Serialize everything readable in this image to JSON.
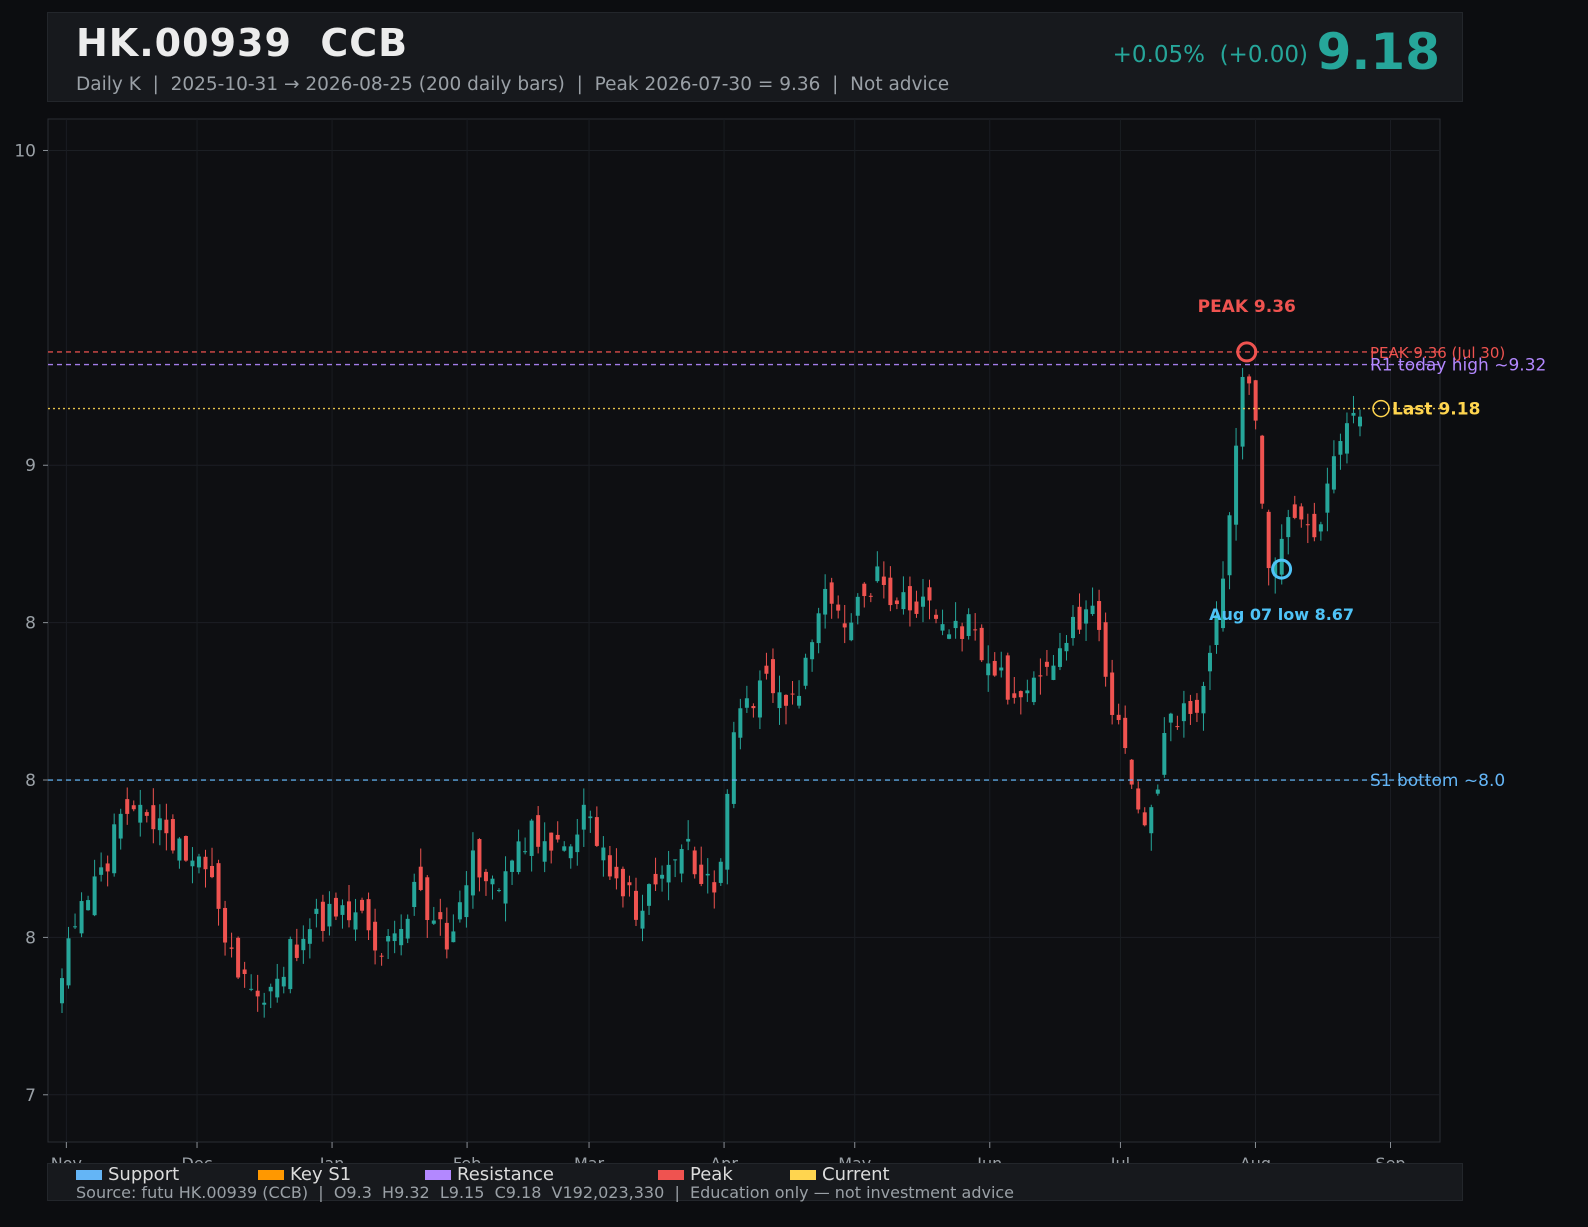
{
  "header": {
    "ticker": "HK.00939  CCB",
    "subtitle": "Daily K  |  2025-10-31 → 2026-08-25 (200 daily bars)  |  Peak 2026-07-30 = 9.36  |  Not advice",
    "change": "+0.05%  (+0.00)",
    "price": "9.18"
  },
  "legend": {
    "items": [
      {
        "label": "Support",
        "color": "#64b5f6"
      },
      {
        "label": "Key S1",
        "color": "#ff9800"
      },
      {
        "label": "Resistance",
        "color": "#b388ff"
      },
      {
        "label": "Peak",
        "color": "#ef5350"
      },
      {
        "label": "Current",
        "color": "#ffd54f"
      }
    ],
    "source": "Source: futu HK.00939 (CCB)  |  O9.3  H9.32  L9.15  C9.18  V192,023,330  |  Education only — not investment advice"
  },
  "colors": {
    "up": "#26a69a",
    "down": "#ef5350",
    "support": "#64b5f6",
    "resistance": "#b388ff",
    "peak": "#ef5350",
    "current": "#ffd54f"
  },
  "chart_data": {
    "type": "candlestick",
    "ylim": [
      6.85,
      10.1
    ],
    "yticks": [
      {
        "value": 7,
        "label": "7"
      },
      {
        "value": 7.5,
        "label": "8"
      },
      {
        "value": 8,
        "label": "8"
      },
      {
        "value": 8.5,
        "label": "8"
      },
      {
        "value": 9,
        "label": "9"
      },
      {
        "value": 10,
        "label": "10"
      }
    ],
    "xticks": [
      {
        "date": "2025-11-01",
        "label": "Nov"
      },
      {
        "date": "2025-12-01",
        "label": "Dec"
      },
      {
        "date": "2026-01-01",
        "label": "Jan"
      },
      {
        "date": "2026-02-01",
        "label": "Feb"
      },
      {
        "date": "2026-03-01",
        "label": "Mar"
      },
      {
        "date": "2026-04-01",
        "label": "Apr"
      },
      {
        "date": "2026-05-01",
        "label": "May"
      },
      {
        "date": "2026-06-01",
        "label": "Jun"
      },
      {
        "date": "2026-07-01",
        "label": "Jul"
      },
      {
        "date": "2026-08-01",
        "label": "Aug"
      },
      {
        "date": "2026-09-01",
        "label": "Sep"
      }
    ],
    "start_date": "2025-10-31",
    "end_date": "2026-08-25",
    "close_path": [
      {
        "date": "2025-10-31",
        "value": 7.42
      },
      {
        "date": "2025-11-04",
        "value": 7.58
      },
      {
        "date": "2025-11-10",
        "value": 7.73
      },
      {
        "date": "2025-11-14",
        "value": 7.95
      },
      {
        "date": "2025-11-20",
        "value": 7.87
      },
      {
        "date": "2025-11-26",
        "value": 7.8
      },
      {
        "date": "2025-12-03",
        "value": 7.75
      },
      {
        "date": "2025-12-08",
        "value": 7.5
      },
      {
        "date": "2025-12-14",
        "value": 7.3
      },
      {
        "date": "2025-12-20",
        "value": 7.4
      },
      {
        "date": "2025-12-28",
        "value": 7.55
      },
      {
        "date": "2026-01-05",
        "value": 7.6
      },
      {
        "date": "2026-01-12",
        "value": 7.48
      },
      {
        "date": "2026-01-20",
        "value": 7.63
      },
      {
        "date": "2026-01-28",
        "value": 7.5
      },
      {
        "date": "2026-02-02",
        "value": 7.75
      },
      {
        "date": "2026-02-08",
        "value": 7.64
      },
      {
        "date": "2026-02-16",
        "value": 7.84
      },
      {
        "date": "2026-02-22",
        "value": 7.78
      },
      {
        "date": "2026-02-28",
        "value": 7.9
      },
      {
        "date": "2026-03-06",
        "value": 7.72
      },
      {
        "date": "2026-03-12",
        "value": 7.6
      },
      {
        "date": "2026-03-18",
        "value": 7.66
      },
      {
        "date": "2026-03-24",
        "value": 7.78
      },
      {
        "date": "2026-03-30",
        "value": 7.62
      },
      {
        "date": "2026-04-03",
        "value": 8.15
      },
      {
        "date": "2026-04-10",
        "value": 8.3
      },
      {
        "date": "2026-04-16",
        "value": 8.22
      },
      {
        "date": "2026-04-20",
        "value": 8.35
      },
      {
        "date": "2026-04-23",
        "value": 8.58
      },
      {
        "date": "2026-04-30",
        "value": 8.5
      },
      {
        "date": "2026-05-06",
        "value": 8.65
      },
      {
        "date": "2026-05-13",
        "value": 8.55
      },
      {
        "date": "2026-05-20",
        "value": 8.52
      },
      {
        "date": "2026-05-27",
        "value": 8.48
      },
      {
        "date": "2026-06-03",
        "value": 8.35
      },
      {
        "date": "2026-06-07",
        "value": 8.26
      },
      {
        "date": "2026-06-14",
        "value": 8.38
      },
      {
        "date": "2026-06-20",
        "value": 8.48
      },
      {
        "date": "2026-06-24",
        "value": 8.56
      },
      {
        "date": "2026-06-28",
        "value": 8.32
      },
      {
        "date": "2026-07-03",
        "value": 8.0
      },
      {
        "date": "2026-07-07",
        "value": 7.8
      },
      {
        "date": "2026-07-12",
        "value": 8.2
      },
      {
        "date": "2026-07-17",
        "value": 8.2
      },
      {
        "date": "2026-07-22",
        "value": 8.4
      },
      {
        "date": "2026-07-26",
        "value": 8.82
      },
      {
        "date": "2026-07-30",
        "value": 9.36
      },
      {
        "date": "2026-08-01",
        "value": 9.12
      },
      {
        "date": "2026-08-04",
        "value": 8.72
      },
      {
        "date": "2026-08-07",
        "value": 8.75
      },
      {
        "date": "2026-08-10",
        "value": 8.85
      },
      {
        "date": "2026-08-14",
        "value": 8.76
      },
      {
        "date": "2026-08-18",
        "value": 8.92
      },
      {
        "date": "2026-08-21",
        "value": 9.15
      },
      {
        "date": "2026-08-25",
        "value": 9.18
      }
    ],
    "levels": [
      {
        "name": "peak",
        "value": 9.36,
        "label": "PEAK 9.36 (Jul 30)",
        "style": "dashed"
      },
      {
        "name": "resistance",
        "value": 9.32,
        "label": "R1 today high ~9.32",
        "style": "dashed"
      },
      {
        "name": "current",
        "value": 9.18,
        "label": "Last 9.18",
        "style": "dotted"
      },
      {
        "name": "support",
        "value": 8.0,
        "label": "S1 bottom ~8.0",
        "style": "dashed"
      }
    ],
    "annotations": [
      {
        "name": "peak-marker",
        "date": "2026-07-30",
        "value": 9.36,
        "label": "PEAK 9.36"
      },
      {
        "name": "low-marker",
        "date": "2026-08-07",
        "value": 8.67,
        "label": "Aug 07 low 8.67"
      }
    ]
  }
}
